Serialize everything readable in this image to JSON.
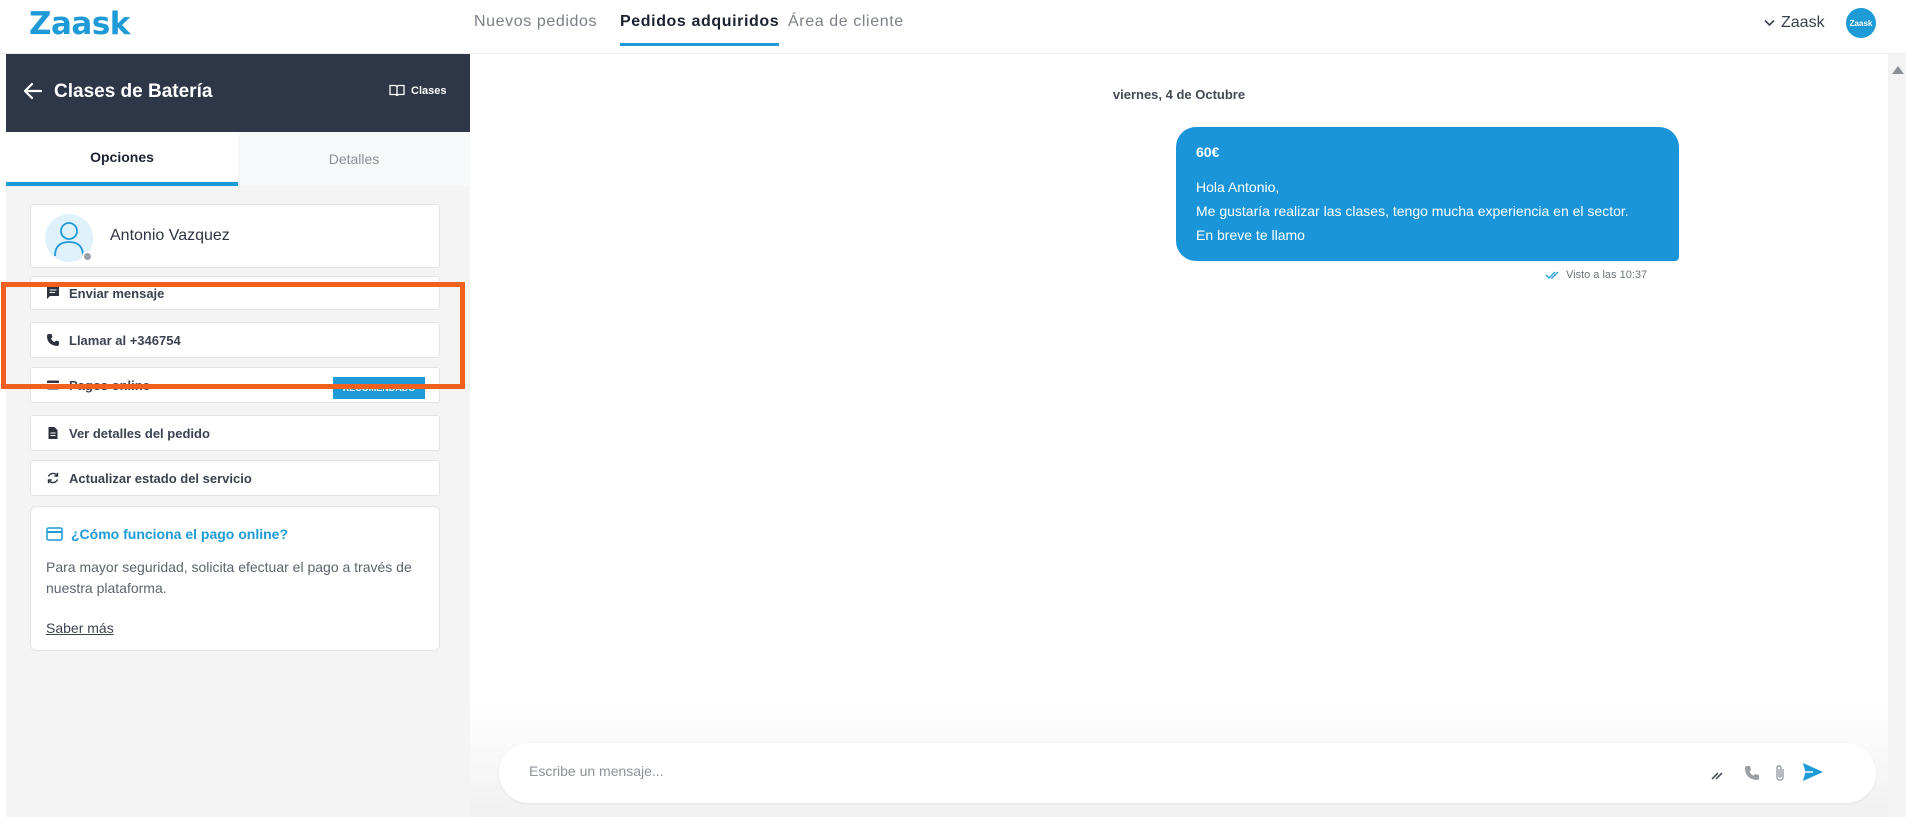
{
  "nav": {
    "logo": "Zaask",
    "links": [
      "Nuevos pedidos",
      "Pedidos adquiridos",
      "Área de cliente"
    ],
    "account_name": "Zaask",
    "avatar_text": "Zaask"
  },
  "panel": {
    "title": "Clases de Batería",
    "category": "Clases",
    "tabs": [
      "Opciones",
      "Detalles"
    ],
    "contact_name": "Antonio Vazquez",
    "actions": {
      "message": "Enviar mensaje",
      "call": "Llamar al +346754",
      "online_payment": "Pagos online",
      "recommended": "RECOMENDADO",
      "order_details": "Ver detalles del pedido",
      "update_status": "Actualizar estado del servicio"
    },
    "info": {
      "title": "¿Cómo funciona el pago online?",
      "text": "Para mayor seguridad, solicita efectuar el pago a través de nuestra plataforma.",
      "link": "Saber más"
    }
  },
  "chat": {
    "date": "viernes, 4 de Octubre",
    "message": {
      "price": "60€",
      "lines": [
        "Hola Antonio,",
        "Me gustaría realizar las clases, tengo mucha experiencia en el sector.",
        "En breve te llamo"
      ],
      "seen": "Visto a las 10:37"
    },
    "composer_placeholder": "Escribe un mensaje..."
  },
  "colors": {
    "brand": "#1e9ad6",
    "header_dark": "#2d3748",
    "highlight": "#f2601d"
  }
}
